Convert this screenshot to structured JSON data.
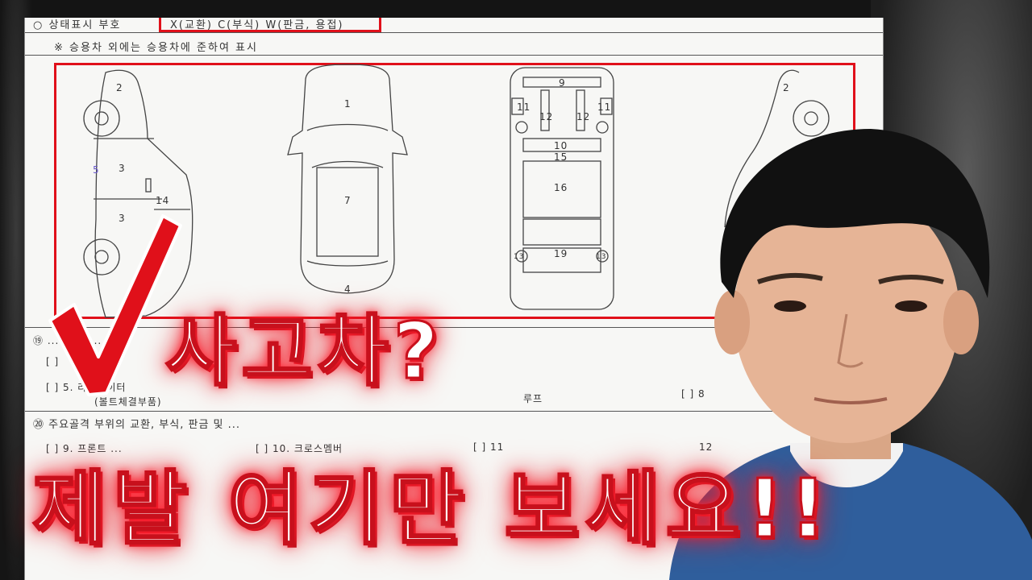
{
  "doc": {
    "status_legend_label": "○ 상태표시 부호",
    "status_legend_codes": "X(교환)  C(부식)  W(판금, 용접)",
    "note": "※ 승용차 외에는 승용차에 준하여 표시",
    "row19_label": "⑲ ... 교환, ...",
    "row19_items": [
      "[ ]",
      "[ ] 5. 라디에이터",
      "(볼트체결부품)",
      "루프",
      "[ ] 8"
    ],
    "row20_label": "⑳ 주요골격 부위의 교환, 부식, 판금 및 ...",
    "row20_items": [
      "[ ] 9. 프론트 ...",
      "[ ] 10. 크로스멤버",
      "[ ] 11",
      "12"
    ]
  },
  "diagram_numbers": {
    "side_left": [
      "2",
      "3",
      "3",
      "14",
      "5"
    ],
    "top_view": [
      "1",
      "7",
      "4"
    ],
    "bottom_view": [
      "9",
      "11",
      "12",
      "12",
      "11",
      "10",
      "15",
      "16",
      "19",
      "13",
      "13"
    ],
    "side_right": [
      "2"
    ]
  },
  "overlay": {
    "title_main": "사고차?",
    "title_sub": "제발 여기만 보세요!!"
  },
  "colors": {
    "accent_red": "#e0101a",
    "text_fill": "#ffffff",
    "doc_bg": "#f7f7f5"
  }
}
